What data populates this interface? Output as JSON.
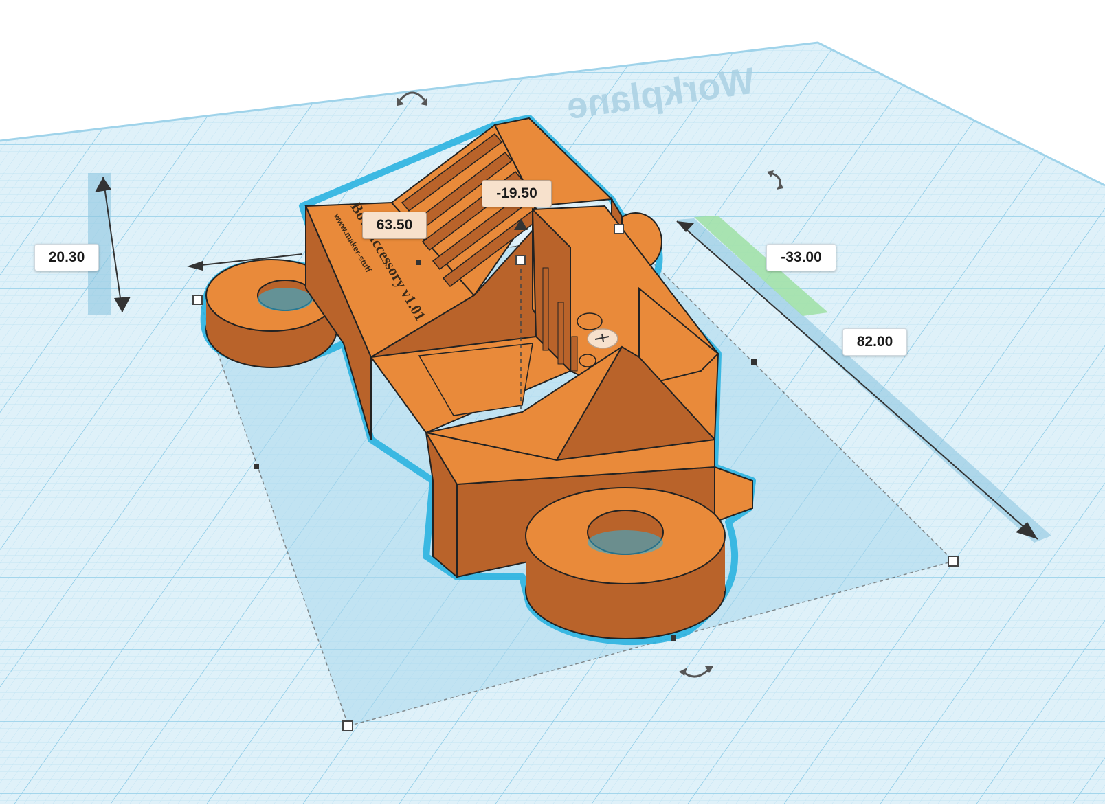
{
  "workplane": {
    "label": "Workplane"
  },
  "model_text": {
    "line1": "Bow Accessory v1.01",
    "line2": "www.maker-stuff"
  },
  "dimensions": {
    "height": "20.30",
    "width": "63.50",
    "elevation": "-19.50",
    "offset": "-33.00",
    "length": "82.00"
  },
  "colors": {
    "grid_bg": "#dff1f9",
    "grid_minor": "#b8dff0",
    "grid_major": "#8ccbe6",
    "model_orange": "#e98a3a",
    "model_dark": "#b9632a",
    "selection_outline": "#2bb3e0",
    "footprint": "#a9d8ee",
    "offset_green": "#9fe0a4"
  },
  "icons": {
    "rotate_top": "rotate-arrow-icon",
    "rotate_right": "rotate-arrow-icon",
    "rotate_bottom": "rotate-arrow-icon",
    "height_arrow": "double-arrow-icon",
    "lift_cone": "lift-cone-icon"
  }
}
